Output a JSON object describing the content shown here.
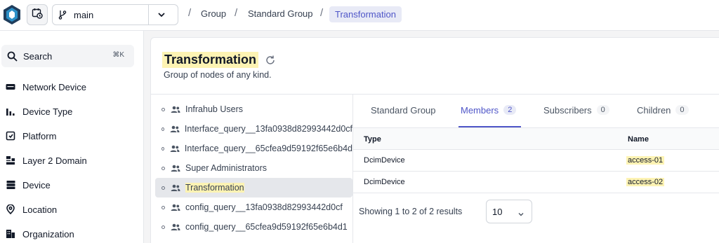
{
  "header": {
    "branch": "main",
    "breadcrumbs": [
      "Group",
      "Standard Group",
      "Transformation"
    ],
    "separator": "/"
  },
  "sidebar": {
    "search_label": "Search",
    "search_shortcut": "⌘K",
    "items": [
      {
        "label": "Network Device",
        "icon": "server-icon"
      },
      {
        "label": "Device Type",
        "icon": "bar-chart-icon"
      },
      {
        "label": "Platform",
        "icon": "platform-icon"
      },
      {
        "label": "Layer 2 Domain",
        "icon": "network-icon"
      },
      {
        "label": "Device",
        "icon": "device-stack-icon"
      },
      {
        "label": "Location",
        "icon": "location-pin-icon"
      },
      {
        "label": "Organization",
        "icon": "building-icon"
      }
    ]
  },
  "main": {
    "title": "Transformation",
    "description": "Group of nodes of any kind.",
    "tree": [
      {
        "label": "Infrahub Users",
        "selected": false
      },
      {
        "label": "Interface_query__13fa0938d82993442d0cf",
        "selected": false
      },
      {
        "label": "Interface_query__65cfea9d59192f65e6b4d",
        "selected": false
      },
      {
        "label": "Super Administrators",
        "selected": false
      },
      {
        "label": "Transformation",
        "selected": true
      },
      {
        "label": "config_query__13fa0938d82993442d0cf",
        "selected": false
      },
      {
        "label": "config_query__65cfea9d59192f65e6b4d1",
        "selected": false
      }
    ],
    "tabs": [
      {
        "label": "Standard Group",
        "count": null,
        "active": false
      },
      {
        "label": "Members",
        "count": "2",
        "active": true
      },
      {
        "label": "Subscribers",
        "count": "0",
        "active": false
      },
      {
        "label": "Children",
        "count": "0",
        "active": false
      }
    ],
    "table": {
      "columns": [
        "Type",
        "Name"
      ],
      "rows": [
        {
          "type": "DcimDevice",
          "name": "access-01"
        },
        {
          "type": "DcimDevice",
          "name": "access-02"
        }
      ]
    },
    "pagination": {
      "summary": "Showing 1 to 2 of 2 results",
      "page_size": "10"
    }
  },
  "colors": {
    "accent": "#4f56c8",
    "highlight": "#fdf3b3",
    "logo": "#1f6b9c"
  }
}
